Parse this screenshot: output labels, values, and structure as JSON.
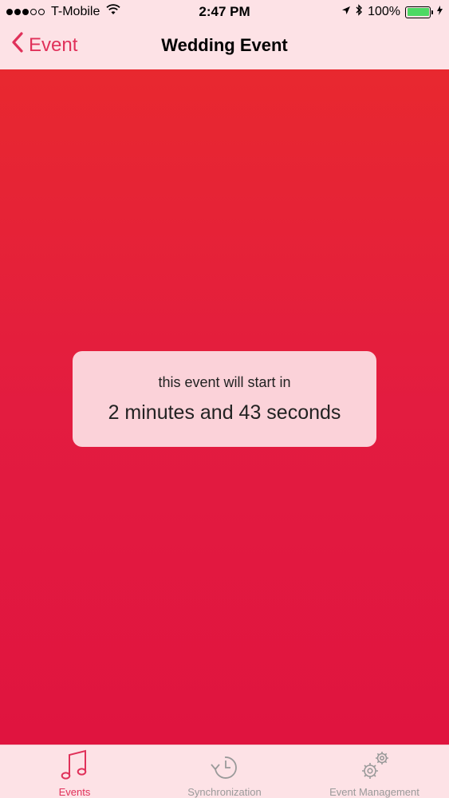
{
  "status_bar": {
    "carrier": "T-Mobile",
    "time": "2:47 PM",
    "battery_percent": "100%",
    "signal_bars_filled": 3,
    "signal_bars_total": 5
  },
  "nav": {
    "back_label": "Event",
    "title": "Wedding Event"
  },
  "countdown": {
    "label": "this event will start in",
    "value": "2 minutes and 43 seconds"
  },
  "tabs": [
    {
      "label": "Events",
      "icon": "music-note-icon",
      "active": true
    },
    {
      "label": "Synchronization",
      "icon": "clock-sync-icon",
      "active": false
    },
    {
      "label": "Event Management",
      "icon": "gears-icon",
      "active": false
    }
  ],
  "colors": {
    "accent": "#e0315a",
    "background_top": "#e8282f",
    "background_bottom": "#e0143f",
    "bar_background": "#fde2e6",
    "battery": "#4cd964"
  }
}
